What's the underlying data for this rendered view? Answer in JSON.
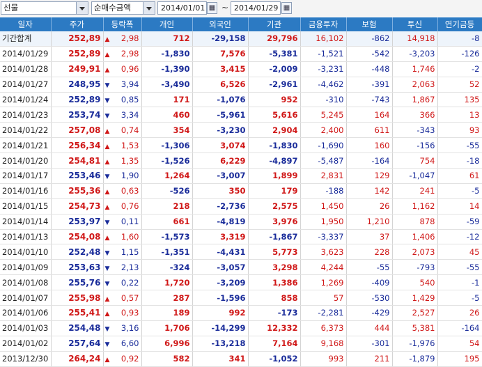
{
  "toolbar": {
    "market": "선물",
    "metric": "순매수금액",
    "start_date": "2014/01/01",
    "end_date": "2014/01/29",
    "separator": "~",
    "calendar_icon": "calendar-icon"
  },
  "columns": [
    "일자",
    "주가",
    "등락폭",
    "개인",
    "외국인",
    "기관",
    "금융투자",
    "보험",
    "투신",
    "연기금등"
  ],
  "colors": {
    "header_bg": "#2c7ac3",
    "up": "#d01818",
    "down": "#1a2c9a"
  },
  "rows": [
    {
      "date": "기간합계",
      "price": "252,89",
      "dir": "up",
      "change": "2,98",
      "ind": "712",
      "frg": "-29,158",
      "inst": "29,796",
      "fin": "16,102",
      "ins": "-862",
      "trust": "14,918",
      "pen": "-8"
    },
    {
      "date": "2014/01/29",
      "price": "252,89",
      "dir": "up",
      "change": "2,98",
      "ind": "-1,830",
      "frg": "7,576",
      "inst": "-5,381",
      "fin": "-1,521",
      "ins": "-542",
      "trust": "-3,203",
      "pen": "-126"
    },
    {
      "date": "2014/01/28",
      "price": "249,91",
      "dir": "up",
      "change": "0,96",
      "ind": "-1,390",
      "frg": "3,415",
      "inst": "-2,009",
      "fin": "-3,231",
      "ins": "-448",
      "trust": "1,746",
      "pen": "-2"
    },
    {
      "date": "2014/01/27",
      "price": "248,95",
      "dir": "down",
      "change": "3,94",
      "ind": "-3,490",
      "frg": "6,526",
      "inst": "-2,961",
      "fin": "-4,462",
      "ins": "-391",
      "trust": "2,063",
      "pen": "52"
    },
    {
      "date": "2014/01/24",
      "price": "252,89",
      "dir": "down",
      "change": "0,85",
      "ind": "171",
      "frg": "-1,076",
      "inst": "952",
      "fin": "-310",
      "ins": "-743",
      "trust": "1,867",
      "pen": "135"
    },
    {
      "date": "2014/01/23",
      "price": "253,74",
      "dir": "down",
      "change": "3,34",
      "ind": "460",
      "frg": "-5,961",
      "inst": "5,616",
      "fin": "5,245",
      "ins": "164",
      "trust": "366",
      "pen": "13"
    },
    {
      "date": "2014/01/22",
      "price": "257,08",
      "dir": "up",
      "change": "0,74",
      "ind": "354",
      "frg": "-3,230",
      "inst": "2,904",
      "fin": "2,400",
      "ins": "611",
      "trust": "-343",
      "pen": "93"
    },
    {
      "date": "2014/01/21",
      "price": "256,34",
      "dir": "up",
      "change": "1,53",
      "ind": "-1,306",
      "frg": "3,074",
      "inst": "-1,830",
      "fin": "-1,690",
      "ins": "160",
      "trust": "-156",
      "pen": "-55"
    },
    {
      "date": "2014/01/20",
      "price": "254,81",
      "dir": "up",
      "change": "1,35",
      "ind": "-1,526",
      "frg": "6,229",
      "inst": "-4,897",
      "fin": "-5,487",
      "ins": "-164",
      "trust": "754",
      "pen": "-18"
    },
    {
      "date": "2014/01/17",
      "price": "253,46",
      "dir": "down",
      "change": "1,90",
      "ind": "1,264",
      "frg": "-3,007",
      "inst": "1,899",
      "fin": "2,831",
      "ins": "129",
      "trust": "-1,047",
      "pen": "61"
    },
    {
      "date": "2014/01/16",
      "price": "255,36",
      "dir": "up",
      "change": "0,63",
      "ind": "-526",
      "frg": "350",
      "inst": "179",
      "fin": "-188",
      "ins": "142",
      "trust": "241",
      "pen": "-5"
    },
    {
      "date": "2014/01/15",
      "price": "254,73",
      "dir": "up",
      "change": "0,76",
      "ind": "218",
      "frg": "-2,736",
      "inst": "2,575",
      "fin": "1,450",
      "ins": "26",
      "trust": "1,162",
      "pen": "14"
    },
    {
      "date": "2014/01/14",
      "price": "253,97",
      "dir": "down",
      "change": "0,11",
      "ind": "661",
      "frg": "-4,819",
      "inst": "3,976",
      "fin": "1,950",
      "ins": "1,210",
      "trust": "878",
      "pen": "-59"
    },
    {
      "date": "2014/01/13",
      "price": "254,08",
      "dir": "up",
      "change": "1,60",
      "ind": "-1,573",
      "frg": "3,319",
      "inst": "-1,867",
      "fin": "-3,337",
      "ins": "37",
      "trust": "1,406",
      "pen": "-12"
    },
    {
      "date": "2014/01/10",
      "price": "252,48",
      "dir": "down",
      "change": "1,15",
      "ind": "-1,351",
      "frg": "-4,431",
      "inst": "5,773",
      "fin": "3,623",
      "ins": "228",
      "trust": "2,073",
      "pen": "45"
    },
    {
      "date": "2014/01/09",
      "price": "253,63",
      "dir": "down",
      "change": "2,13",
      "ind": "-324",
      "frg": "-3,057",
      "inst": "3,298",
      "fin": "4,244",
      "ins": "-55",
      "trust": "-793",
      "pen": "-55"
    },
    {
      "date": "2014/01/08",
      "price": "255,76",
      "dir": "down",
      "change": "0,22",
      "ind": "1,720",
      "frg": "-3,209",
      "inst": "1,386",
      "fin": "1,269",
      "ins": "-409",
      "trust": "540",
      "pen": "-1"
    },
    {
      "date": "2014/01/07",
      "price": "255,98",
      "dir": "up",
      "change": "0,57",
      "ind": "287",
      "frg": "-1,596",
      "inst": "858",
      "fin": "57",
      "ins": "-530",
      "trust": "1,429",
      "pen": "-5"
    },
    {
      "date": "2014/01/06",
      "price": "255,41",
      "dir": "up",
      "change": "0,93",
      "ind": "189",
      "frg": "992",
      "inst": "-173",
      "fin": "-2,281",
      "ins": "-429",
      "trust": "2,527",
      "pen": "26"
    },
    {
      "date": "2014/01/03",
      "price": "254,48",
      "dir": "down",
      "change": "3,16",
      "ind": "1,706",
      "frg": "-14,299",
      "inst": "12,332",
      "fin": "6,373",
      "ins": "444",
      "trust": "5,381",
      "pen": "-164"
    },
    {
      "date": "2014/01/02",
      "price": "257,64",
      "dir": "down",
      "change": "6,60",
      "ind": "6,996",
      "frg": "-13,218",
      "inst": "7,164",
      "fin": "9,168",
      "ins": "-301",
      "trust": "-1,976",
      "pen": "54"
    },
    {
      "date": "2013/12/30",
      "price": "264,24",
      "dir": "up",
      "change": "0,92",
      "ind": "582",
      "frg": "341",
      "inst": "-1,052",
      "fin": "993",
      "ins": "211",
      "trust": "-1,879",
      "pen": "195"
    }
  ]
}
